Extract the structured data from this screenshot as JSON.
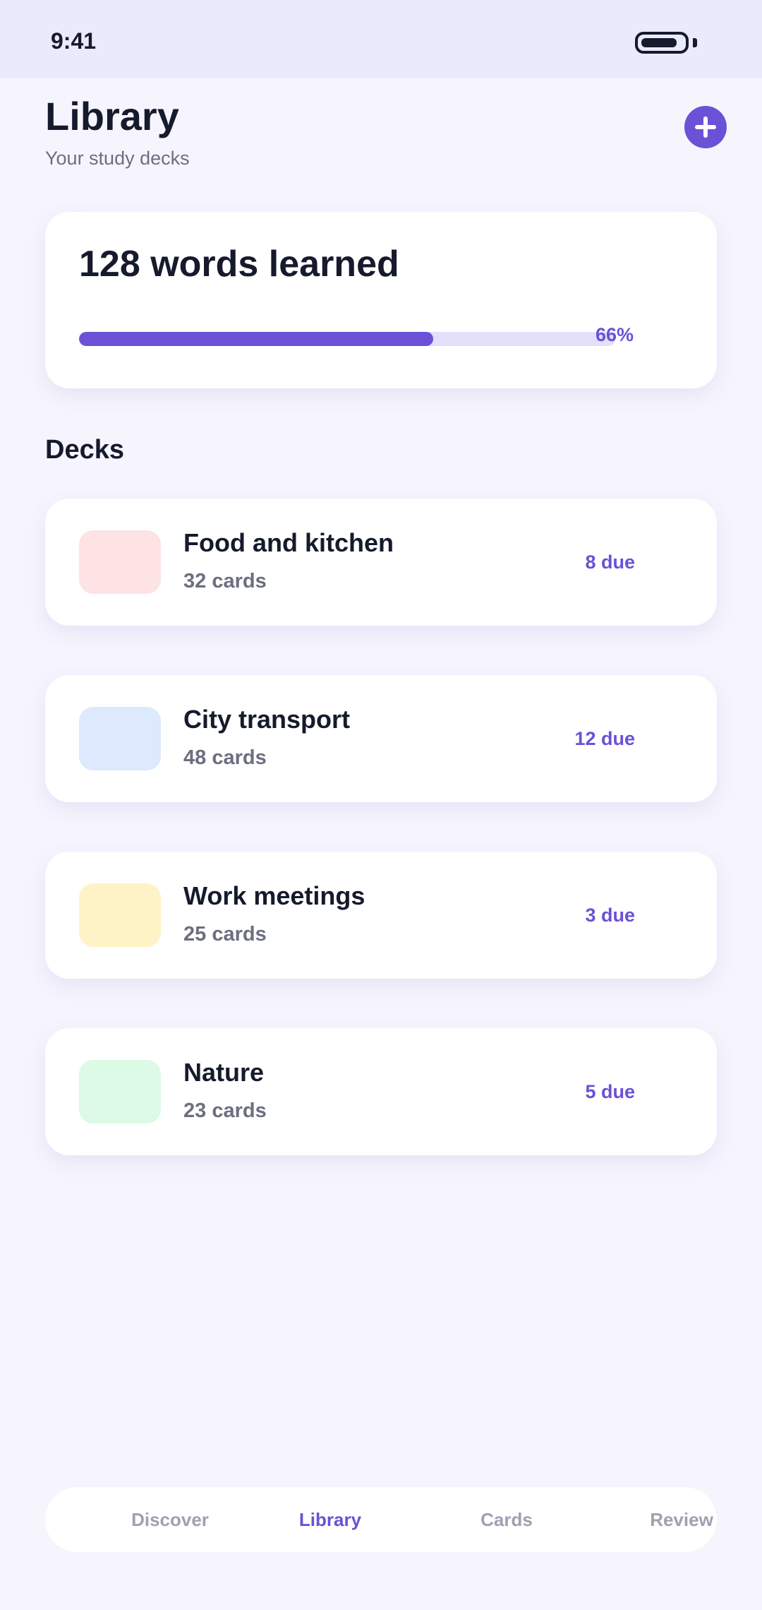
{
  "status_bar": {
    "time": "9:41"
  },
  "header": {
    "title": "Library",
    "subtitle": "Your study decks",
    "add_icon": "plus-icon"
  },
  "progress": {
    "title": "128 words learned",
    "percent_label": "66%",
    "fraction": 0.66
  },
  "decks_section": {
    "title": "Decks",
    "items": [
      {
        "name": "Food and kitchen",
        "count": "32 cards",
        "due": "8 due",
        "color": "#fde3e4"
      },
      {
        "name": "City transport",
        "count": "48 cards",
        "due": "12 due",
        "color": "#dde9fc"
      },
      {
        "name": "Work meetings",
        "count": "25 cards",
        "due": "3 due",
        "color": "#fef3c7"
      },
      {
        "name": "Nature",
        "count": "23 cards",
        "due": "5 due",
        "color": "#dcfae6"
      }
    ]
  },
  "bottom_nav": {
    "items": [
      {
        "label": "Discover",
        "active": false
      },
      {
        "label": "Library",
        "active": true
      },
      {
        "label": "Cards",
        "active": false
      },
      {
        "label": "Review",
        "active": false
      }
    ]
  },
  "colors": {
    "accent": "#6b51d6",
    "background": "#f6f5fe",
    "status_bar": "#ebeafd",
    "text_primary": "#151a2c",
    "text_secondary": "#6b6f80",
    "nav_inactive": "#9ea1b2"
  }
}
